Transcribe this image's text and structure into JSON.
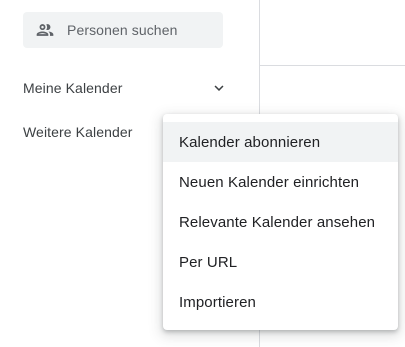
{
  "search": {
    "placeholder": "Personen suchen",
    "icon": "people-icon"
  },
  "sidebar": {
    "my_calendars_label": "Meine Kalender",
    "my_calendars_icon": "chevron-down-icon",
    "other_calendars_label": "Weitere Kalender"
  },
  "menu": {
    "items": [
      {
        "label": "Kalender abonnieren",
        "highlighted": true
      },
      {
        "label": "Neuen Kalender einrichten"
      },
      {
        "label": "Relevante Kalender ansehen"
      },
      {
        "label": "Per URL"
      },
      {
        "label": "Importieren"
      }
    ]
  },
  "colors": {
    "search_bg": "#f1f3f4",
    "text": "#3c4043",
    "menu_text": "#202124",
    "divider": "#dadce0",
    "hover_bg": "#f1f3f4"
  }
}
